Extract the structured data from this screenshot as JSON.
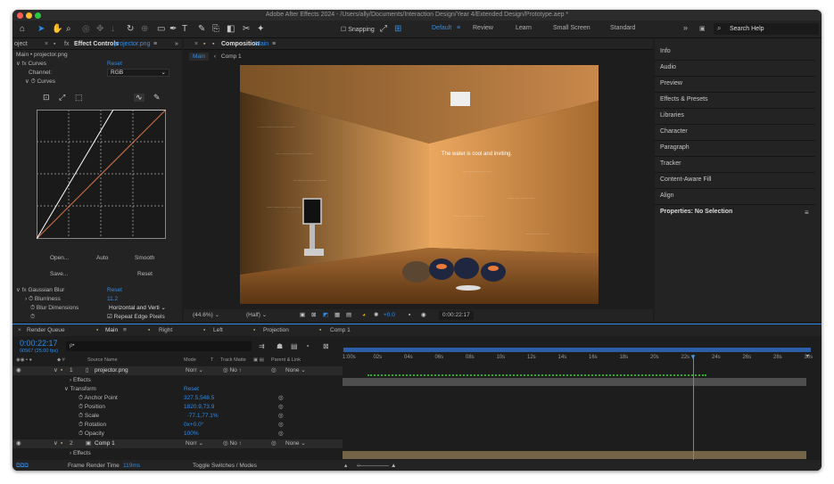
{
  "title": "Adobe After Effects 2024 - /Users/ally/Documents/Interaction Design/Year 4/Extended Design/Prototype.aep *",
  "toolbar": {
    "snapping": "Snapping",
    "workspaces": [
      "Default",
      "Review",
      "Learn",
      "Small Screen",
      "Standard"
    ],
    "search": "Search Help"
  },
  "effects_panel": {
    "tab_project": "oject",
    "tab_label": "Effect Controls",
    "tab_file": "projector.png",
    "layer_path": "Main • projector.png",
    "curves": {
      "name": "Curves",
      "reset": "Reset",
      "channel_label": "Channel:",
      "channel_value": "RGB",
      "curves_label": "Curves",
      "buttons": [
        "Open...",
        "Auto",
        "Smooth",
        "Save...",
        "Reset"
      ]
    },
    "blur": {
      "name": "Gaussian Blur",
      "reset": "Reset",
      "blurriness_label": "Blurriness",
      "blurriness_value": "11.2",
      "dimensions_label": "Blur Dimensions",
      "dimensions_value": "Horizontal and Verti",
      "repeat_label": "Repeat Edge Pixels"
    }
  },
  "comp_panel": {
    "tab": "Composition",
    "tab_comp": "Main",
    "crumb_main": "Main",
    "crumb_comp1": "Comp 1",
    "wall_text": "The water is cool and inviting.",
    "zoom": "(44.6%)",
    "res": "(Half)",
    "exposure": "+0.0",
    "timecode": "0:00:22:17"
  },
  "right_panel": {
    "items": [
      "Info",
      "Audio",
      "Preview",
      "Effects & Presets",
      "Libraries",
      "Character",
      "Paragraph",
      "Tracker",
      "Content-Aware Fill",
      "Align"
    ],
    "properties": "Properties: No Selection"
  },
  "timeline": {
    "tabs": [
      "Render Queue",
      "Main",
      "Right",
      "Left",
      "Projection",
      "Comp 1"
    ],
    "time": "0:00:22:17",
    "frames": "00567 (25.00 fps)",
    "search_placeholder": "ρ•",
    "col_source": "Source Name",
    "col_mode": "Mode",
    "col_t": "T",
    "col_trkmat": "Track Matte",
    "col_parent": "Parent & Link",
    "layers": [
      {
        "num": "1",
        "name": "projector.png",
        "mode": "Norr",
        "matte": "No ↑",
        "parent": "None"
      },
      {
        "num": "2",
        "name": "Comp 1",
        "mode": "Norr",
        "matte": "No ↑",
        "parent": "None"
      }
    ],
    "props": [
      {
        "name": "Effects",
        "value": ""
      },
      {
        "name": "Transform",
        "value": "Reset"
      },
      {
        "name": "Anchor Point",
        "value": "327.5,548.5"
      },
      {
        "name": "Position",
        "value": "1820.9,73.9"
      },
      {
        "name": "Scale",
        "value": "∙77.1,77.1%"
      },
      {
        "name": "Rotation",
        "value": "0x+0.0°"
      },
      {
        "name": "Opacity",
        "value": "100%"
      }
    ],
    "effects2": "Effects",
    "ticks": [
      "1:00s",
      "02s",
      "04s",
      "06s",
      "08s",
      "10s",
      "12s",
      "14s",
      "16s",
      "18s",
      "20s",
      "22s",
      "24s",
      "26s",
      "28s",
      "30s"
    ],
    "render_label": "Frame Render Time",
    "render_value": "119ms",
    "toggle": "Toggle Switches / Modes"
  },
  "colors": {
    "accent": "#2d8ceb",
    "bg": "#1d1d1d",
    "panel": "#232323"
  }
}
